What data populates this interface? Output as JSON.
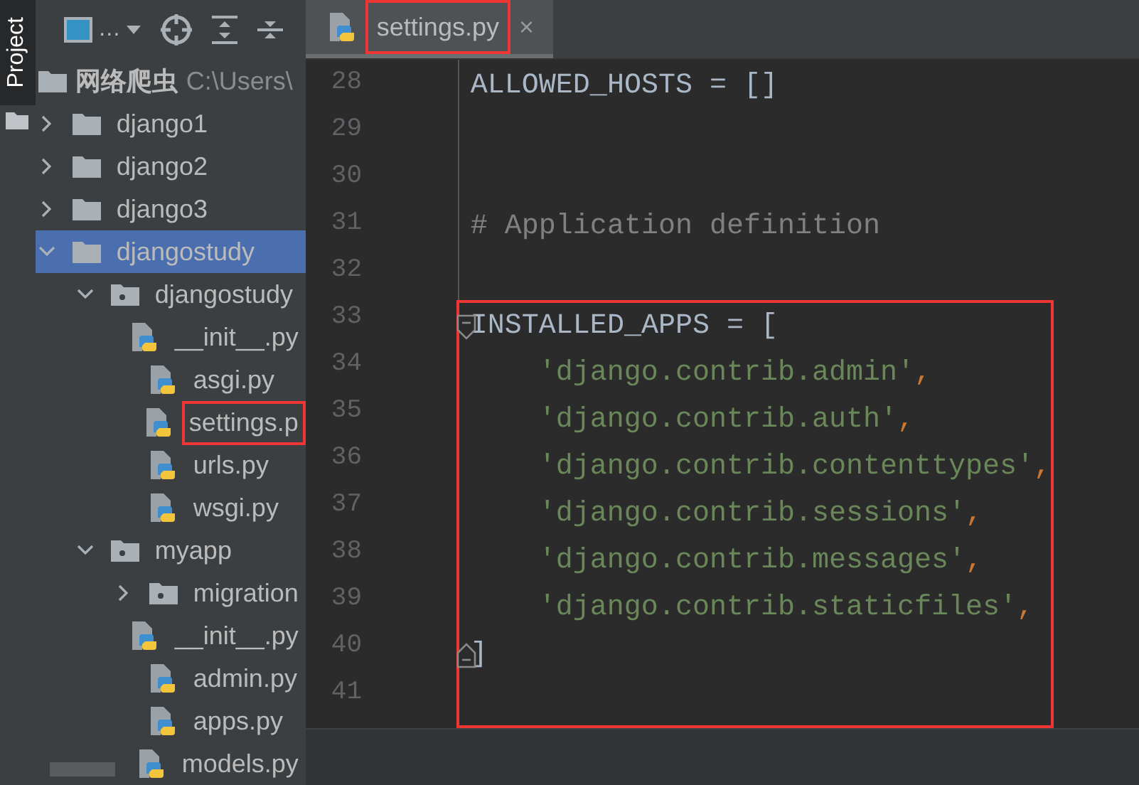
{
  "side_bar": {
    "tab": {
      "label": "Project",
      "selected": true
    }
  },
  "project_panel": {
    "toolbar": {
      "view_label": "…"
    },
    "root": {
      "name": "网络爬虫",
      "path": "C:\\Users\\"
    },
    "items": [
      {
        "name": "django1",
        "kind": "folder",
        "expanded": false,
        "selected": false,
        "highlighted": false
      },
      {
        "name": "django2",
        "kind": "folder",
        "expanded": false,
        "selected": false,
        "highlighted": false
      },
      {
        "name": "django3",
        "kind": "folder",
        "expanded": false,
        "selected": false,
        "highlighted": false
      },
      {
        "name": "djangostudy",
        "kind": "folder",
        "expanded": true,
        "selected": true,
        "highlighted": false,
        "children": [
          {
            "name": "djangostudy",
            "kind": "package",
            "expanded": true,
            "selected": false,
            "highlighted": false,
            "children": [
              {
                "name": "__init__.py",
                "kind": "python",
                "selected": false,
                "highlighted": false
              },
              {
                "name": "asgi.py",
                "kind": "python",
                "selected": false,
                "highlighted": false
              },
              {
                "name": "settings.p",
                "kind": "python",
                "selected": false,
                "highlighted": true
              },
              {
                "name": "urls.py",
                "kind": "python",
                "selected": false,
                "highlighted": false
              },
              {
                "name": "wsgi.py",
                "kind": "python",
                "selected": false,
                "highlighted": false
              }
            ]
          },
          {
            "name": "myapp",
            "kind": "package",
            "expanded": true,
            "selected": false,
            "highlighted": false,
            "children": [
              {
                "name": "migration",
                "kind": "package",
                "expanded": false,
                "selected": false,
                "highlighted": false
              },
              {
                "name": "__init__.py",
                "kind": "python",
                "selected": false,
                "highlighted": false
              },
              {
                "name": "admin.py",
                "kind": "python",
                "selected": false,
                "highlighted": false
              },
              {
                "name": "apps.py",
                "kind": "python",
                "selected": false,
                "highlighted": false
              },
              {
                "name": "models.py",
                "kind": "python",
                "selected": false,
                "highlighted": false
              }
            ]
          }
        ]
      }
    ]
  },
  "editor": {
    "tabs": [
      {
        "label": "settings.py",
        "selected": true,
        "highlighted": true,
        "close": "×"
      }
    ],
    "sections": [
      {
        "boxed": false,
        "lines": [
          {
            "number": "28",
            "fold_start": false,
            "fold_end": false,
            "tokens": [
              {
                "kind": "plain",
                "text": "ALLOWED_HOSTS = []"
              }
            ]
          },
          {
            "number": "29",
            "fold_start": false,
            "fold_end": false
          },
          {
            "number": "30",
            "fold_start": false,
            "fold_end": false
          },
          {
            "number": "31",
            "fold_start": false,
            "fold_end": false,
            "tokens": [
              {
                "kind": "comment",
                "text": "# Application definition"
              }
            ]
          },
          {
            "number": "32",
            "fold_start": false,
            "fold_end": false
          }
        ]
      },
      {
        "boxed": true,
        "lines": [
          {
            "number": "33",
            "fold_start": true,
            "fold_end": false,
            "tokens": [
              {
                "kind": "plain",
                "text": "INSTALLED_APPS = ["
              }
            ]
          },
          {
            "number": "34",
            "fold_start": false,
            "fold_end": false,
            "tokens": [
              {
                "kind": "string",
                "text": "'django.contrib.admin'"
              },
              {
                "kind": "punct",
                "text": ","
              }
            ]
          },
          {
            "number": "35",
            "fold_start": false,
            "fold_end": false,
            "tokens": [
              {
                "kind": "string",
                "text": "'django.contrib.auth'"
              },
              {
                "kind": "punct",
                "text": ","
              }
            ]
          },
          {
            "number": "36",
            "fold_start": false,
            "fold_end": false,
            "tokens": [
              {
                "kind": "string",
                "text": "'django.contrib.contenttypes'"
              },
              {
                "kind": "punct",
                "text": ","
              }
            ]
          },
          {
            "number": "37",
            "fold_start": false,
            "fold_end": false,
            "tokens": [
              {
                "kind": "string",
                "text": "'django.contrib.sessions'"
              },
              {
                "kind": "punct",
                "text": ","
              }
            ]
          },
          {
            "number": "38",
            "fold_start": false,
            "fold_end": false,
            "tokens": [
              {
                "kind": "string",
                "text": "'django.contrib.messages'"
              },
              {
                "kind": "punct",
                "text": ","
              }
            ]
          },
          {
            "number": "39",
            "fold_start": false,
            "fold_end": false,
            "tokens": [
              {
                "kind": "string",
                "text": "'django.contrib.staticfiles'"
              },
              {
                "kind": "punct",
                "text": ","
              }
            ]
          },
          {
            "number": "40",
            "fold_start": false,
            "fold_end": true,
            "tokens": [
              {
                "kind": "plain",
                "text": "]"
              }
            ]
          },
          {
            "number": "41",
            "fold_start": false,
            "fold_end": false
          }
        ]
      }
    ]
  }
}
